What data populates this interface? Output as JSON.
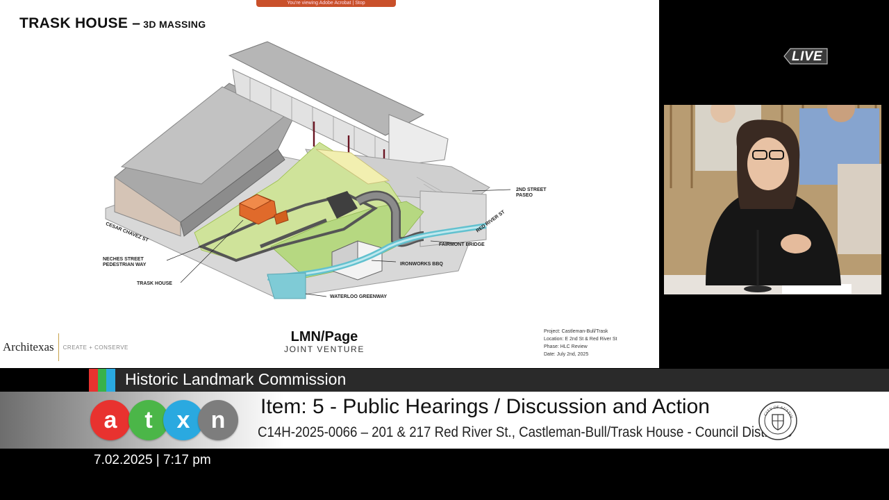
{
  "slide": {
    "share_banner": "You're viewing  Adobe Acrobat  |  Stop",
    "title": "TRASK HOUSE –",
    "title_sub": "3D MASSING",
    "callouts": {
      "cesar_chavez": "CESAR CHAVEZ ST",
      "neches_1": "NECHES STREET",
      "neches_2": "PEDESTRIAN WAY",
      "trask_house": "TRASK HOUSE",
      "waterloo": "WATERLOO GREENWAY",
      "ironworks": "IRONWORKS BBQ",
      "fairmont": "FAIRMONT BRIDGE",
      "red_river": "RED RIVER ST",
      "paseo_1": "2ND STREET",
      "paseo_2": "PASEO"
    },
    "footer": {
      "architexas": "Architexas",
      "tagline": "CREATE + CONSERVE",
      "lmn": "LMN/Page",
      "joint_venture": "JOINT VENTURE",
      "project_line": "Project:  Castleman-Bull/Trask",
      "location_line": "Location:  E 2nd St & Red River St",
      "phase_line": "Phase:  HLC Review",
      "date_line": "Date:  July 2nd, 2025"
    }
  },
  "live_label": "LIVE",
  "lower_third": {
    "commission": "Historic Landmark Commission",
    "stripe_colors": [
      "#e8322f",
      "#38b24a",
      "#2aa9e0"
    ],
    "logo_letters": [
      {
        "letter": "a",
        "color": "#e8322f"
      },
      {
        "letter": "t",
        "color": "#4bb648"
      },
      {
        "letter": "x",
        "color": "#2aa9e0"
      },
      {
        "letter": "n",
        "color": "#7d7d7d"
      }
    ],
    "item": "Item: 5 - Public Hearings / Discussion and Action",
    "case": "C14H-2025-0066 – 201 & 217 Red River St., Castleman-Bull/Trask House - Council District 9",
    "seal_text": "CITY OF AUSTIN",
    "datetime": "7.02.2025 | 7:17 pm"
  }
}
